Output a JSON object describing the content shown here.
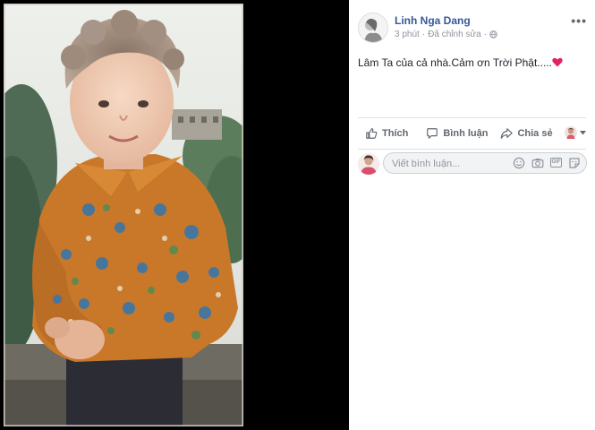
{
  "post": {
    "author": "Linh Nga Dang",
    "time": "3 phút",
    "separator": "·",
    "edited": "Đã chỉnh sửa",
    "text": "Lâm Ta của cả nhà.Cảm ơn Trời Phật.....",
    "more_icon": "more-horizontal-icon",
    "privacy_icon": "globe-icon",
    "reaction_icon": "red-heart-icon"
  },
  "actions": [
    {
      "label": "Thích",
      "icon": "thumbs-up-icon"
    },
    {
      "label": "Bình luận",
      "icon": "comment-bubble-icon"
    },
    {
      "label": "Chia sẻ",
      "icon": "share-arrow-icon"
    }
  ],
  "comment": {
    "placeholder": "Viết bình luận...",
    "tools": [
      "emoji-icon",
      "camera-icon",
      "gif-icon",
      "sticker-icon"
    ],
    "gif_label": "GIF"
  },
  "colors": {
    "link": "#385898",
    "muted": "#90949c",
    "action_text": "#606770",
    "heart": "#e0245e"
  }
}
